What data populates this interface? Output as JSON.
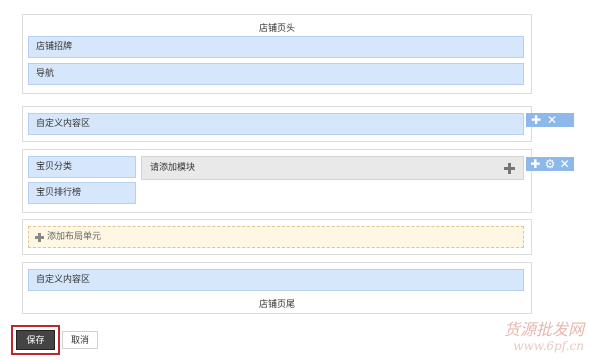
{
  "header": {
    "title": "店铺页头",
    "sign_label": "店铺招牌",
    "nav_label": "导航"
  },
  "custom_area_1": {
    "label": "自定义内容区"
  },
  "layout_row": {
    "category_label": "宝贝分类",
    "ranking_label": "宝贝排行榜",
    "add_module_label": "请添加模块"
  },
  "add_layout_unit": {
    "label": "添加布局单元"
  },
  "footer": {
    "custom_label": "自定义内容区",
    "title": "店铺页尾"
  },
  "actions": {
    "save_label": "保存",
    "cancel_label": "取消"
  },
  "watermark": {
    "line1": "货源批发网",
    "line2": "www.6pf.cn"
  },
  "colors": {
    "module_blue": "#d6e6fb",
    "toolbar_blue": "#8db8ea",
    "save_highlight": "#c0272d"
  }
}
